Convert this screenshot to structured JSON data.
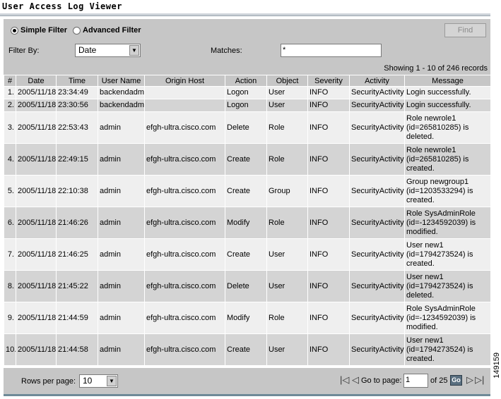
{
  "title": "User Access Log Viewer",
  "filter": {
    "simple_label": "Simple Filter",
    "advanced_label": "Advanced Filter",
    "find_label": "Find",
    "filter_by_label": "Filter By:",
    "filter_by_value": "Date",
    "matches_label": "Matches:",
    "matches_value": "*"
  },
  "showing": "Showing 1 - 10 of 246 records",
  "columns": [
    "#",
    "Date",
    "Time",
    "User Name",
    "Origin Host",
    "Action",
    "Object",
    "Severity",
    "Activity",
    "Message"
  ],
  "rows": [
    {
      "n": "1.",
      "date": "2005/11/18",
      "time": "23:34:49",
      "user": "backendadm",
      "host": "",
      "action": "Logon",
      "object": "User",
      "severity": "INFO",
      "activity": "SecurityActivity",
      "message": "Login successfully."
    },
    {
      "n": "2.",
      "date": "2005/11/18",
      "time": "23:30:56",
      "user": "backendadm",
      "host": "",
      "action": "Logon",
      "object": "User",
      "severity": "INFO",
      "activity": "SecurityActivity",
      "message": "Login successfully."
    },
    {
      "n": "3.",
      "date": "2005/11/18",
      "time": "22:53:43",
      "user": "admin",
      "host": "efgh-ultra.cisco.com",
      "action": "Delete",
      "object": "Role",
      "severity": "INFO",
      "activity": "SecurityActivity",
      "message": "Role newrole1 (id=265810285) is deleted."
    },
    {
      "n": "4.",
      "date": "2005/11/18",
      "time": "22:49:15",
      "user": "admin",
      "host": "efgh-ultra.cisco.com",
      "action": "Create",
      "object": "Role",
      "severity": "INFO",
      "activity": "SecurityActivity",
      "message": "Role newrole1 (id=265810285) is created."
    },
    {
      "n": "5.",
      "date": "2005/11/18",
      "time": "22:10:38",
      "user": "admin",
      "host": "efgh-ultra.cisco.com",
      "action": "Create",
      "object": "Group",
      "severity": "INFO",
      "activity": "SecurityActivity",
      "message": "Group newgroup1 (id=1203533294) is created."
    },
    {
      "n": "6.",
      "date": "2005/11/18",
      "time": "21:46:26",
      "user": "admin",
      "host": "efgh-ultra.cisco.com",
      "action": "Modify",
      "object": "Role",
      "severity": "INFO",
      "activity": "SecurityActivity",
      "message": "Role SysAdminRole (id=-1234592039) is modified."
    },
    {
      "n": "7.",
      "date": "2005/11/18",
      "time": "21:46:25",
      "user": "admin",
      "host": "efgh-ultra.cisco.com",
      "action": "Create",
      "object": "User",
      "severity": "INFO",
      "activity": "SecurityActivity",
      "message": "User new1 (id=1794273524) is created."
    },
    {
      "n": "8.",
      "date": "2005/11/18",
      "time": "21:45:22",
      "user": "admin",
      "host": "efgh-ultra.cisco.com",
      "action": "Delete",
      "object": "User",
      "severity": "INFO",
      "activity": "SecurityActivity",
      "message": "User new1 (id=1794273524) is deleted."
    },
    {
      "n": "9.",
      "date": "2005/11/18",
      "time": "21:44:59",
      "user": "admin",
      "host": "efgh-ultra.cisco.com",
      "action": "Modify",
      "object": "Role",
      "severity": "INFO",
      "activity": "SecurityActivity",
      "message": "Role SysAdminRole (id=-1234592039) is modified."
    },
    {
      "n": "10.",
      "date": "2005/11/18",
      "time": "21:44:58",
      "user": "admin",
      "host": "efgh-ultra.cisco.com",
      "action": "Create",
      "object": "User",
      "severity": "INFO",
      "activity": "SecurityActivity",
      "message": "User new1 (id=1794273524) is created."
    }
  ],
  "pager": {
    "rows_per_page_label": "Rows per page:",
    "rows_per_page_value": "10",
    "goto_label": "Go to page:",
    "page_value": "1",
    "of_label": "of 25",
    "go_label": "Go"
  },
  "figure_id": "149159"
}
